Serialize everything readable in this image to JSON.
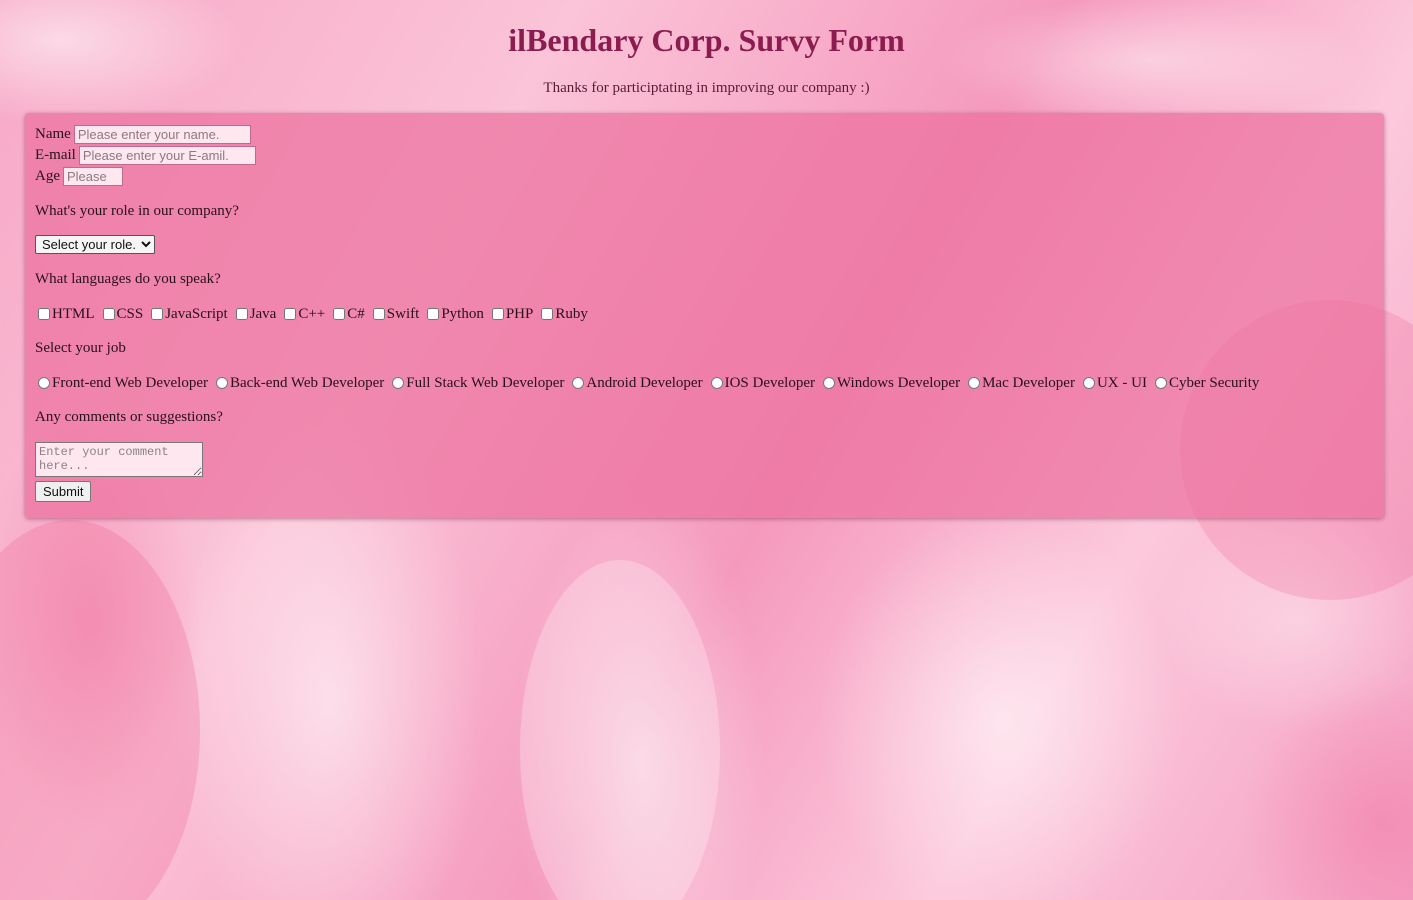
{
  "header": {
    "title": "ilBendary Corp. Survy Form",
    "subtitle": "Thanks for participtating in improving our company :)"
  },
  "form": {
    "name_label": "Name",
    "name_placeholder": "Please enter your name.",
    "email_label": "E-mail",
    "email_placeholder": "Please enter your E-amil.",
    "age_label": "Age",
    "age_placeholder": "Please",
    "role_question": "What's your role in our company?",
    "role_selected": "Select your role.",
    "languages_question": "What languages do you speak?",
    "languages": [
      "HTML",
      "CSS",
      "JavaScript",
      "Java",
      "C++",
      "C#",
      "Swift",
      "Python",
      "PHP",
      "Ruby"
    ],
    "job_question": "Select your job",
    "jobs": [
      "Front-end Web Developer",
      "Back-end Web Developer",
      "Full Stack Web Developer",
      "Android Developer",
      "IOS Developer",
      "Windows Developer",
      "Mac Developer",
      "UX - UI",
      "Cyber Security"
    ],
    "comments_question": "Any comments or suggestions?",
    "comment_placeholder": "Enter your comment here...",
    "submit_label": "Submit"
  },
  "colors": {
    "title": "#8b1c4f",
    "card": "#ec709e",
    "background": "#f7a8c6"
  }
}
